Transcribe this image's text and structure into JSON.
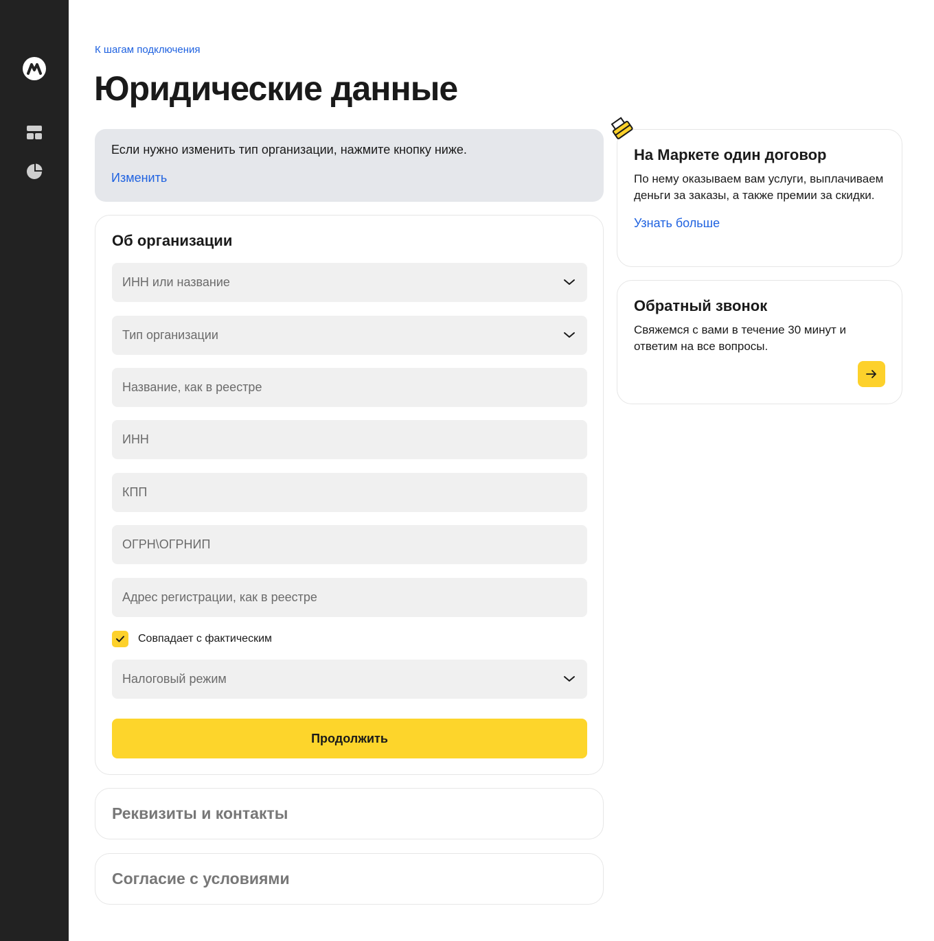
{
  "sidebar": {
    "logo": "market-logo-icon",
    "items": [
      {
        "icon": "dashboard-icon"
      },
      {
        "icon": "pie-chart-icon"
      }
    ]
  },
  "header": {
    "back_link": "К шагам подключения",
    "title": "Юридические данные"
  },
  "notice": {
    "text": "Если нужно изменить тип организации, нажмите кнопку ниже.",
    "link": "Изменить"
  },
  "org_section": {
    "title": "Об организации",
    "fields": {
      "inn_or_name": "ИНН или название",
      "org_type": "Тип организации",
      "registry_name": "Название, как в реестре",
      "inn": "ИНН",
      "kpp": "КПП",
      "ogrn": "ОГРН\\ОГРНИП",
      "address": "Адрес регистрации, как в реестре",
      "tax_mode": "Налоговый режим"
    },
    "checkbox_label": "Совпадает с фактическим",
    "checkbox_checked": true,
    "submit_label": "Продолжить"
  },
  "collapsed_sections": {
    "requisites": "Реквизиты и контакты",
    "agreement": "Согласие с условиями"
  },
  "contract_card": {
    "title": "На Маркете один договор",
    "text": "По нему оказываем вам услуги, выплачиваем деньги за заказы, а также премии за скидки.",
    "link": "Узнать больше"
  },
  "callback_card": {
    "title": "Обратный звонок",
    "text": "Свяжемся с вами в течение 30 минут и ответим на все вопросы."
  },
  "colors": {
    "accent_yellow": "#fdd52b",
    "link_blue": "#1f62e0",
    "sidebar_bg": "#222222"
  }
}
